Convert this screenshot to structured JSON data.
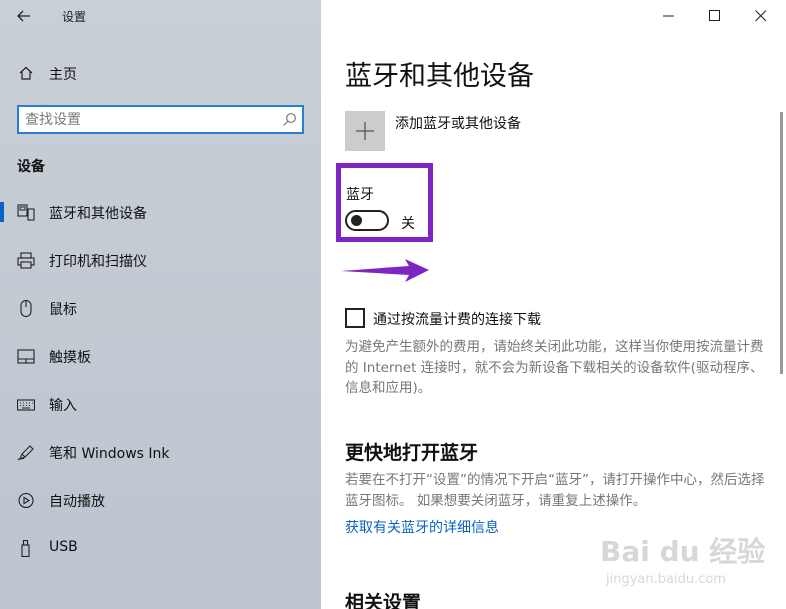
{
  "window": {
    "title": "设置"
  },
  "sidebar": {
    "home_label": "主页",
    "search_placeholder": "查找设置",
    "section_title": "设备",
    "items": [
      {
        "label": "蓝牙和其他设备",
        "icon": "bluetooth-devices-icon",
        "active": true
      },
      {
        "label": "打印机和扫描仪",
        "icon": "printer-icon"
      },
      {
        "label": "鼠标",
        "icon": "mouse-icon"
      },
      {
        "label": "触摸板",
        "icon": "touchpad-icon"
      },
      {
        "label": "输入",
        "icon": "keyboard-icon"
      },
      {
        "label": "笔和 Windows Ink",
        "icon": "pen-icon"
      },
      {
        "label": "自动播放",
        "icon": "autoplay-icon"
      },
      {
        "label": "USB",
        "icon": "usb-icon"
      }
    ]
  },
  "main": {
    "title": "蓝牙和其他设备",
    "add_device_label": "添加蓝牙或其他设备",
    "bluetooth": {
      "label": "蓝牙",
      "state_label": "关",
      "on": false
    },
    "metered": {
      "checkbox_label": "通过按流量计费的连接下载",
      "checked": false,
      "description": "为避免产生额外的费用，请始终关闭此功能，这样当你使用按流量计费的 Internet 连接时，就不会为新设备下载相关的设备软件(驱动程序、信息和应用)。"
    },
    "quick_open": {
      "heading": "更快地打开蓝牙",
      "description": "若要在不打开“设置”的情况下开启“蓝牙”，请打开操作中心，然后选择蓝牙图标。 如果想要关闭蓝牙，请重复上述操作。",
      "link": "获取有关蓝牙的详细信息"
    },
    "related_heading": "相关设置"
  },
  "annotation": {
    "highlight_color": "#7e25c4"
  },
  "watermark": {
    "main": "Bai du 经验",
    "sub": "jingyan.baidu.com"
  },
  "colors": {
    "accent": "#0a63c4",
    "sidebar_bg": "#c4cbd3"
  }
}
